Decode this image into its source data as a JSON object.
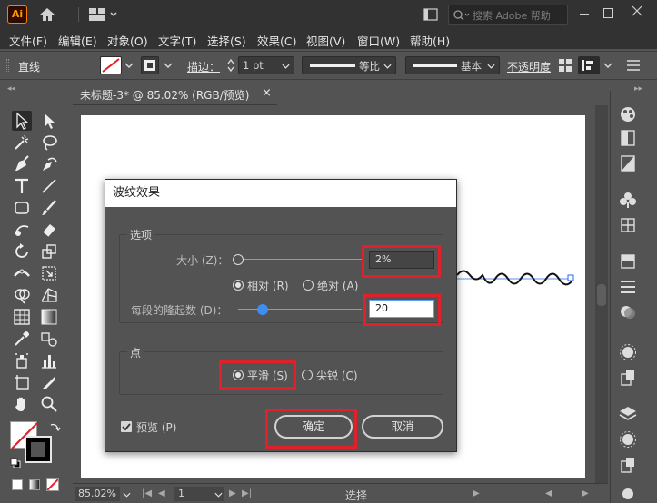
{
  "app": {
    "logo_text": "Ai"
  },
  "search": {
    "placeholder": "搜索 Adobe 帮助"
  },
  "menu": [
    "文件(F)",
    "编辑(E)",
    "对象(O)",
    "文字(T)",
    "选择(S)",
    "效果(C)",
    "视图(V)",
    "窗口(W)",
    "帮助(H)"
  ],
  "control_bar": {
    "tool_label": "直线",
    "stroke_label": "描边：",
    "stroke_value": "1 pt",
    "profile_label": "等比",
    "brush_label": "基本",
    "opacity_label": "不透明度"
  },
  "document": {
    "tab_title": "未标题-3* @ 85.02% (RGB/预览)",
    "close": "×"
  },
  "statusbar": {
    "zoom": "85.02%",
    "page": "1",
    "tool_status": "选择"
  },
  "dialog": {
    "title": "波纹效果",
    "options_group": "选项",
    "size_label": "大小 (Z)：",
    "size_value": "2%",
    "relative_label": "相对 (R)",
    "absolute_label": "绝对 (A)",
    "ridges_label": "每段的隆起数 (D)：",
    "ridges_value": "20",
    "size_slider_fraction": 0.0,
    "ridges_slider_fraction": 0.2,
    "points_group": "点",
    "smooth_label": "平滑 (S)",
    "corner_label": "尖锐 (C)",
    "preview_label": "预览 (P)",
    "ok_label": "确定",
    "cancel_label": "取消"
  },
  "colors": {
    "highlight": "#e0202a",
    "slider_knob": "#3d8ef2",
    "wave_anchor": "#2a6ae8"
  }
}
